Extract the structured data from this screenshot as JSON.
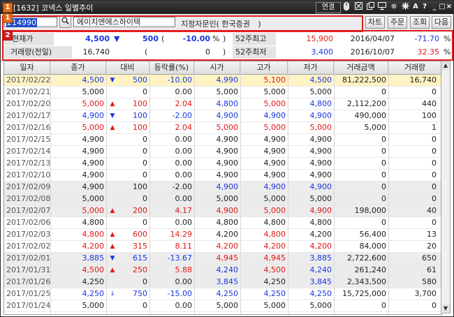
{
  "window": {
    "badge_number": "1",
    "title": "[1632] 코넥스 일별추이",
    "controls": {
      "link_label": "연결",
      "minimize": "_",
      "restore": "□",
      "close": "×",
      "help": "?",
      "font": "A",
      "pin": "⊕"
    }
  },
  "toolbar": {
    "badge_number": "1",
    "code_value": "214990",
    "name_value": "에이치엔에스하이텍",
    "assigned_label": "지정자문인",
    "assigned_paren_open": "(",
    "assigned_value": "한국증권",
    "assigned_paren_close": ")",
    "buttons": [
      "차트",
      "주문",
      "조회",
      "다음"
    ]
  },
  "info": {
    "badge_number": "2",
    "current_price_label": "현재가",
    "current_price": "4,500",
    "change_arrow": "▼",
    "change": "500",
    "change_pct_open": "(",
    "change_pct": "-10.00",
    "change_pct_unit": "%",
    "change_pct_close": ")",
    "volume_label": "거래량(전일)",
    "volume": "16,740",
    "volume_paren_open": "(",
    "volume_prev": "0",
    "volume_paren_close": ")",
    "high52_label": "52주최고",
    "high52_value": "15,900",
    "high52_date": "2016/04/07",
    "high52_pct": "-71.70",
    "high52_unit": "%",
    "low52_label": "52주최저",
    "low52_value": "3,400",
    "low52_date": "2016/10/07",
    "low52_pct": "32.35",
    "low52_unit": "%"
  },
  "table": {
    "columns": [
      "일자",
      "종가",
      "대비",
      "등락률(%)",
      "시가",
      "고가",
      "저가",
      "거래금액",
      "거래량"
    ],
    "rows": [
      {
        "date": "2017/02/22",
        "close": "4,500",
        "arrow": "▼",
        "diff": "500",
        "rate": "-10.00",
        "open": "4,990",
        "high": "5,100",
        "low": "4,500",
        "amount": "81,222,500",
        "volume": "16,740",
        "dir": "down",
        "hl": true
      },
      {
        "date": "2017/02/21",
        "close": "5,000",
        "arrow": "",
        "diff": "0",
        "rate": "0.00",
        "open": "5,000",
        "high": "5,000",
        "low": "5,000",
        "amount": "0",
        "volume": "0",
        "dir": "flat"
      },
      {
        "date": "2017/02/20",
        "close": "5,000",
        "arrow": "▲",
        "diff": "100",
        "rate": "2.04",
        "open": "4,800",
        "high": "5,000",
        "low": "4,800",
        "amount": "2,112,200",
        "volume": "440",
        "dir": "up"
      },
      {
        "date": "2017/02/17",
        "close": "4,900",
        "arrow": "▼",
        "diff": "100",
        "rate": "-2.00",
        "open": "4,900",
        "high": "4,900",
        "low": "4,900",
        "amount": "490,000",
        "volume": "100",
        "dir": "down"
      },
      {
        "date": "2017/02/16",
        "close": "5,000",
        "arrow": "▲",
        "diff": "100",
        "rate": "2.04",
        "open": "5,000",
        "high": "5,000",
        "low": "5,000",
        "amount": "5,000",
        "volume": "1",
        "dir": "up"
      },
      {
        "date": "2017/02/15",
        "close": "4,900",
        "arrow": "",
        "diff": "0",
        "rate": "0.00",
        "open": "4,900",
        "high": "4,900",
        "low": "4,900",
        "amount": "0",
        "volume": "0",
        "dir": "flat"
      },
      {
        "date": "2017/02/14",
        "close": "4,900",
        "arrow": "",
        "diff": "0",
        "rate": "0.00",
        "open": "4,900",
        "high": "4,900",
        "low": "4,900",
        "amount": "0",
        "volume": "0",
        "dir": "flat"
      },
      {
        "date": "2017/02/13",
        "close": "4,900",
        "arrow": "",
        "diff": "0",
        "rate": "0.00",
        "open": "4,900",
        "high": "4,900",
        "low": "4,900",
        "amount": "0",
        "volume": "0",
        "dir": "flat"
      },
      {
        "date": "2017/02/10",
        "close": "4,900",
        "arrow": "",
        "diff": "0",
        "rate": "0.00",
        "open": "4,900",
        "high": "4,900",
        "low": "4,900",
        "amount": "0",
        "volume": "0",
        "dir": "flat"
      },
      {
        "date": "2017/02/09",
        "close": "4,900",
        "arrow": "",
        "diff": "100",
        "rate": "-2.00",
        "open": "4,900",
        "high": "4,900",
        "low": "4,900",
        "amount": "0",
        "volume": "0",
        "dir": "downflat"
      },
      {
        "date": "2017/02/08",
        "close": "5,000",
        "arrow": "",
        "diff": "0",
        "rate": "0.00",
        "open": "5,000",
        "high": "5,000",
        "low": "5,000",
        "amount": "0",
        "volume": "0",
        "dir": "flat"
      },
      {
        "date": "2017/02/07",
        "close": "5,000",
        "arrow": "▲",
        "diff": "200",
        "rate": "4.17",
        "open": "4,900",
        "high": "5,000",
        "low": "4,900",
        "amount": "198,000",
        "volume": "40",
        "dir": "up"
      },
      {
        "date": "2017/02/06",
        "close": "4,800",
        "arrow": "",
        "diff": "0",
        "rate": "0.00",
        "open": "4,800",
        "high": "4,800",
        "low": "4,800",
        "amount": "0",
        "volume": "0",
        "dir": "flat"
      },
      {
        "date": "2017/02/03",
        "close": "4,800",
        "arrow": "▲",
        "diff": "600",
        "rate": "14.29",
        "open": "4,200",
        "high": "4,800",
        "low": "4,200",
        "amount": "56,400",
        "volume": "13",
        "dir": "up"
      },
      {
        "date": "2017/02/02",
        "close": "4,200",
        "arrow": "▲",
        "diff": "315",
        "rate": "8.11",
        "open": "4,200",
        "high": "4,200",
        "low": "4,200",
        "amount": "84,000",
        "volume": "20",
        "dir": "up"
      },
      {
        "date": "2017/02/01",
        "close": "3,885",
        "arrow": "▼",
        "diff": "615",
        "rate": "-13.67",
        "open": "4,945",
        "high": "4,945",
        "low": "3,885",
        "amount": "2,722,600",
        "volume": "650",
        "dir": "down"
      },
      {
        "date": "2017/01/31",
        "close": "4,500",
        "arrow": "▲",
        "diff": "250",
        "rate": "5.88",
        "open": "4,240",
        "high": "4,500",
        "low": "4,240",
        "amount": "261,240",
        "volume": "61",
        "dir": "up"
      },
      {
        "date": "2017/01/26",
        "close": "4,250",
        "arrow": "",
        "diff": "0",
        "rate": "0.00",
        "open": "3,845",
        "high": "4,250",
        "low": "3,845",
        "amount": "2,343,500",
        "volume": "580",
        "dir": "flat"
      },
      {
        "date": "2017/01/25",
        "close": "4,250",
        "arrow": "↓",
        "diff": "750",
        "rate": "-15.00",
        "open": "4,250",
        "high": "4,250",
        "low": "4,250",
        "amount": "15,725,000",
        "volume": "3,700",
        "dir": "down"
      },
      {
        "date": "2017/01/24",
        "close": "5,000",
        "arrow": "",
        "diff": "0",
        "rate": "0.00",
        "open": "5,000",
        "high": "5,000",
        "low": "5,000",
        "amount": "0",
        "volume": "0",
        "dir": "flat"
      }
    ]
  },
  "colors": {
    "up": "#e01818",
    "down": "#1a35e0",
    "highlight": "#fff3c4",
    "frame": "#e02020"
  }
}
